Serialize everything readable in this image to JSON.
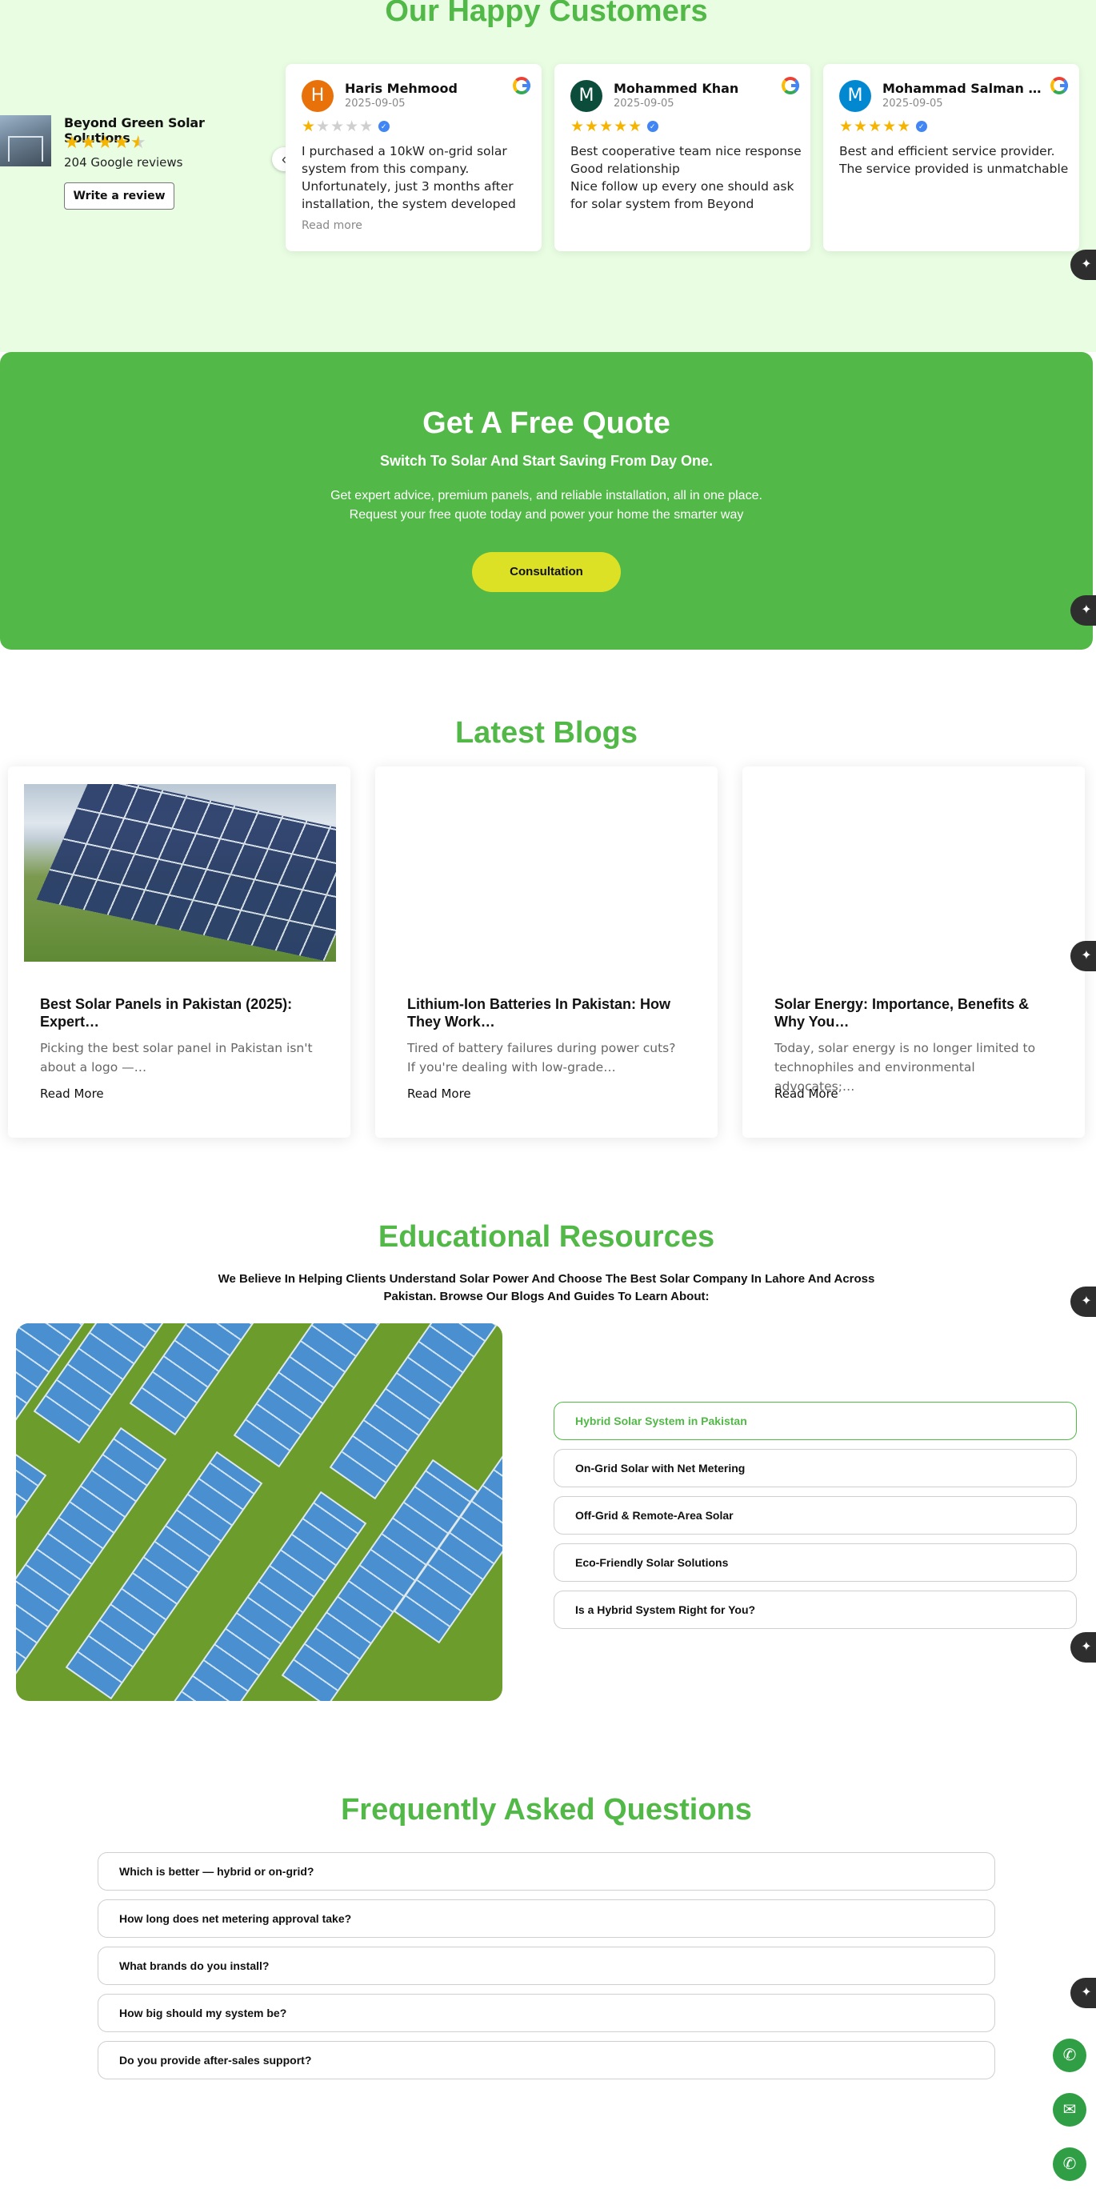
{
  "reviews": {
    "title": "Our Happy Customers",
    "business": {
      "name": "Beyond Green Solar Solutions",
      "rating": 4.5,
      "stars": "★★★★★",
      "count_text": "204 Google reviews",
      "write_review": "Write a review"
    },
    "prev_icon": "chevron-left-icon",
    "items": [
      {
        "initial": "H",
        "name": "Haris Mehmood",
        "date": "2025-09-05",
        "rating": 1,
        "avatar_color": "#e8710a",
        "text": "I purchased a 10kW on-grid solar system from this company. Unfortunately, just 3 months after installation, the system developed a…",
        "read_more": "Read more"
      },
      {
        "initial": "M",
        "name": "Mohammed Khan",
        "date": "2025-09-05",
        "rating": 5,
        "avatar_color": "#0b4c3a",
        "text": "Best cooperative team nice response Good relationship\nNice follow up every one should ask for solar system from Beyond green…"
      },
      {
        "initial": "M",
        "name": "Mohammad Salman Far…",
        "date": "2025-09-05",
        "rating": 5,
        "avatar_color": "#0288d1",
        "text": "Best and efficient service provider. The service provided is unmatchable"
      }
    ]
  },
  "quote": {
    "title": "Get A Free Quote",
    "subtitle": "Switch To Solar And Start Saving From Day One.",
    "body": "Get expert advice, premium panels, and reliable installation, all in one place.\nRequest your free quote today and power your home the smarter way",
    "cta": "Consultation"
  },
  "blogs": {
    "title": "Latest Blogs",
    "items": [
      {
        "title": "Best Solar Panels in Pakistan (2025): Expert…",
        "excerpt": "Picking the best solar panel in Pakistan isn't about a logo —…",
        "read_more": "Read More"
      },
      {
        "title": "Lithium-Ion Batteries In Pakistan: How They Work…",
        "excerpt": "Tired of battery failures during power cuts? If you're dealing with low-grade…",
        "read_more": "Read More"
      },
      {
        "title": "Solar Energy: Importance, Benefits & Why You…",
        "excerpt": "Today, solar energy is no longer limited to technophiles and environmental advocates;…",
        "read_more": "Read More"
      }
    ]
  },
  "education": {
    "title": "Educational Resources",
    "subtitle": "We Believe In Helping Clients Understand Solar Power And Choose The Best Solar Company In Lahore And Across Pakistan. Browse Our Blogs And Guides To Learn About:",
    "topics": [
      "Hybrid Solar System in Pakistan",
      "On-Grid Solar with Net Metering",
      "Off-Grid & Remote-Area Solar",
      "Eco-Friendly Solar Solutions",
      "Is a Hybrid System Right for You?"
    ],
    "active_topic": "Hybrid Solar System in Pakistan"
  },
  "faq": {
    "title": "Frequently Asked Questions",
    "items": [
      "Which is better — hybrid or on-grid?",
      "How long does net metering approval take?",
      "What brands do you install?",
      "How big should my system be?",
      "Do you provide after-sales support?"
    ]
  },
  "floating": {
    "phone_icon": "phone-icon",
    "email_icon": "email-icon",
    "whatsapp_icon": "whatsapp-icon"
  },
  "colors": {
    "brand_green": "#52b847",
    "reviews_bg": "#e8fde2",
    "cta_yellow": "#dce125",
    "float_green": "#2f9e44"
  }
}
